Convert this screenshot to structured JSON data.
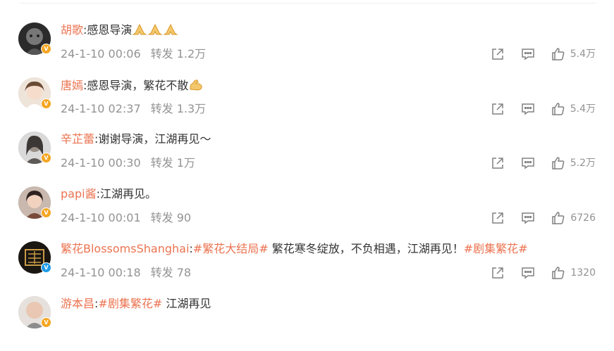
{
  "comments": [
    {
      "username": "胡歌",
      "text": ":感恩导演",
      "emoji": "pray",
      "emoji_count": 3,
      "date": "24-1-10 00:06",
      "forward": "转发 1.2万",
      "likes": "5.4万",
      "badge": "V",
      "badge_color": "#f5a623"
    },
    {
      "username": "唐嫣",
      "text": ":感恩导演，繁花不散",
      "emoji": "muscle",
      "emoji_count": 1,
      "date": "24-1-10 02:37",
      "forward": "转发 1.3万",
      "likes": "5.4万",
      "badge": "V",
      "badge_color": "#f5a623"
    },
    {
      "username": "辛芷蕾",
      "text": ":谢谢导演，江湖再见～",
      "date": "24-1-10 00:30",
      "forward": "转发 1万",
      "likes": "5.2万",
      "badge": "V",
      "badge_color": "#f5a623"
    },
    {
      "username": "papi酱",
      "text": ":江湖再见。",
      "date": "24-1-10 00:01",
      "forward": "转发 90",
      "likes": "6726",
      "badge": "V",
      "badge_color": "#f5a623"
    },
    {
      "username": "繁花BlossomsShanghai",
      "text_before": ":",
      "tag1": "#繁花大结局#",
      "text_mid": " 繁花寒冬绽放，不负相遇，江湖再见！",
      "tag2": "#剧集繁花#",
      "date": "24-1-10 00:18",
      "forward": "转发 78",
      "likes": "1320",
      "badge": "V",
      "badge_color": "#1e9be8"
    },
    {
      "username": "游本昌",
      "text_before": ":",
      "tag1": "#剧集繁花#",
      "text_mid": " 江湖再见",
      "badge": "V",
      "badge_color": "#f5a623"
    }
  ],
  "icons": {
    "share": "share-icon",
    "comment": "comment-icon",
    "like": "thumbs-up-icon",
    "pray": "pray-hands-icon",
    "muscle": "flexed-biceps-icon"
  },
  "colors": {
    "username": "#eb7350",
    "meta": "#939393",
    "text": "#333333"
  }
}
